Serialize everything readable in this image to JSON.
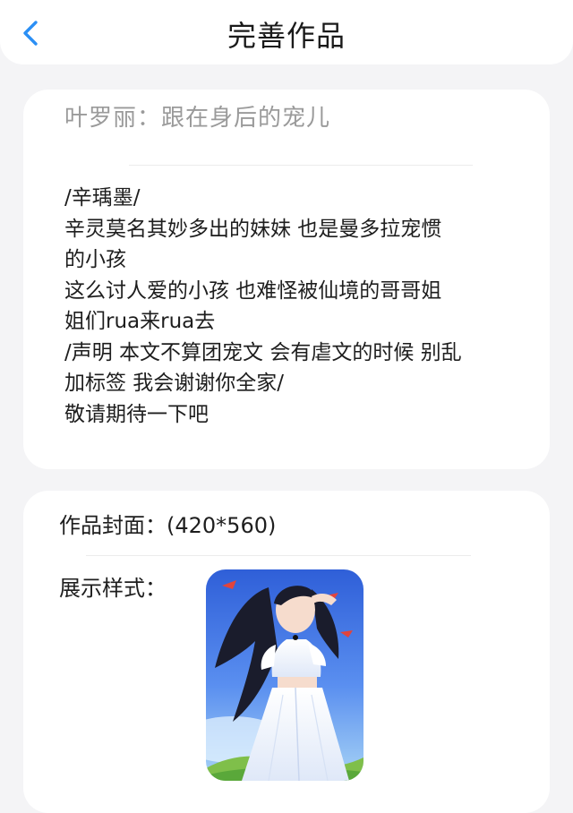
{
  "header": {
    "back_icon": "chevron-left-icon",
    "title": "完善作品",
    "accent_color": "#2b8ff5"
  },
  "intro_card": {
    "work_title": "叶罗丽：跟在身后的宠儿",
    "lines": [
      "/辛瑀墨/",
      "辛灵莫名其妙多出的妹妹 也是曼多拉宠惯",
      "的小孩",
      "这么讨人爱的小孩 也难怪被仙境的哥哥姐",
      "姐们rua来rua去",
      "/声明 本文不算团宠文 会有虐文的时候 别乱",
      "加标签 我会谢谢你全家/",
      "敬请期待一下吧"
    ]
  },
  "cover_card": {
    "cover_label": "作品封面：(420*560)",
    "style_label": "展示样式：",
    "cover_image_name": "cover-illustration"
  }
}
